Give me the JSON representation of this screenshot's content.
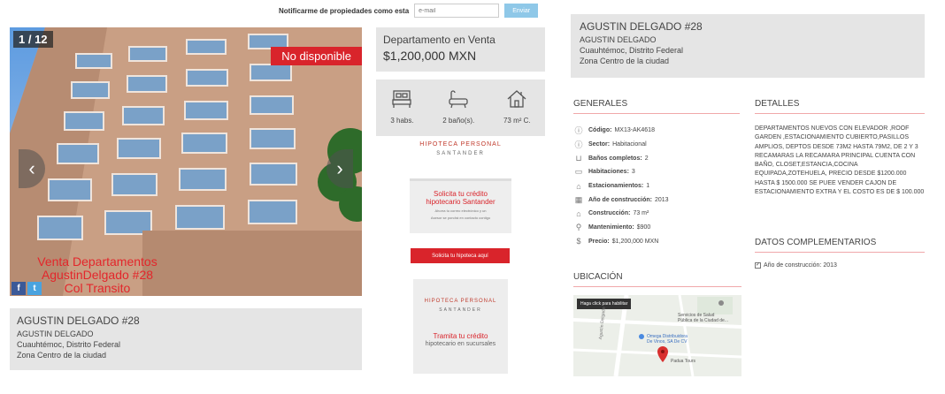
{
  "notify": {
    "label": "Notificarme de propiedades como esta",
    "placeholder": "e-mail",
    "button": "Enviar"
  },
  "gallery": {
    "counter": "1 / 12",
    "status": "No disponible",
    "overlay_lines": [
      "Venta Departamentos",
      "AgustinDelgado #28",
      "Col Transito"
    ],
    "social": [
      "f",
      "t"
    ]
  },
  "address": {
    "title": "AGUSTIN DELGADO #28",
    "line1": "AGUSTIN DELGADO",
    "line2": "Cuauhtémoc, Distrito Federal",
    "line3": "Zona Centro de la ciudad"
  },
  "listing": {
    "type": "Departamento en Venta",
    "price": "$1,200,000 MXN"
  },
  "features": [
    {
      "icon": "bed-icon",
      "label": "3 habs."
    },
    {
      "icon": "bathtub-icon",
      "label": "2 baño(s)."
    },
    {
      "icon": "house-icon",
      "label": "73 m² C."
    }
  ],
  "ads": {
    "brand_title": "HIPOTECA PERSONAL",
    "brand_sub": "SANTANDER",
    "ad1_heading": [
      "Solicita tu crédito",
      "hipotecario Santander"
    ],
    "ad1_sub": [
      "Ahorra tu correo electrónico y un",
      "Asesor se pondrá en contacto contigo"
    ],
    "ad_button": "Solicita tu hipoteca aquí",
    "ad2_heading": "Tramita tu crédito",
    "ad2_sub": "hipotecario en sucursales"
  },
  "generales": {
    "heading": "GENERALES",
    "rows": [
      {
        "icon": "info-icon",
        "label": "Código:",
        "value": "MX13-AK4618"
      },
      {
        "icon": "info-icon",
        "label": "Sector:",
        "value": "Habitacional"
      },
      {
        "icon": "bathtub-icon",
        "label": "Baños completos:",
        "value": "2"
      },
      {
        "icon": "bed-icon",
        "label": "Habitaciones:",
        "value": "3"
      },
      {
        "icon": "garage-icon",
        "label": "Estacionamientos:",
        "value": "1"
      },
      {
        "icon": "calendar-icon",
        "label": "Año de construcción:",
        "value": "2013"
      },
      {
        "icon": "house-icon",
        "label": "Construcción:",
        "value": "73 m²"
      },
      {
        "icon": "wrench-icon",
        "label": "Mantenimiento:",
        "value": "$900"
      },
      {
        "icon": "dollar-icon",
        "label": "Precio:",
        "value": "$1,200,000 MXN"
      }
    ]
  },
  "detalles": {
    "heading": "DETALLES",
    "text": "DEPARTAMENTOS NUEVOS CON ELEVADOR ,ROOF GARDEN ,ESTACIONAMIENTO CUBIERTO,PASILLOS AMPLIOS, DEPTOS DESDE 73M2 HASTA 79M2, DE 2 Y 3 RECAMARAS LA RECAMARA PRINCIPAL CUENTA CON BAÑO, CLOSET,ESTANCIA,COCINA EQUIPADA,ZOTEHUELA, PRECIO DESDE $1200.000 HASTA $ 1500.000 SE PUEE VENDER CAJON DE ESTACIONAMIENTO EXTRA Y EL COSTO ES DE $ 100.000"
  },
  "datos": {
    "heading": "DATOS COMPLEMENTARIOS",
    "item": "Año de construcción: 2013"
  },
  "ubicacion": {
    "heading": "UBICACIÓN",
    "map_button": "Haga click para habilitar",
    "poi1": [
      "Servicios de Salud",
      "Pública de la Ciudad de..."
    ],
    "poi2": [
      "Omega Distribuidora",
      "De Vinos, SA De CV"
    ],
    "poi3": "Padua Tours",
    "street": "Agustín Delgado"
  },
  "colors": {
    "accent": "#d9242b",
    "panel": "#e5e5e5",
    "button_blue": "#8fc8e8"
  }
}
